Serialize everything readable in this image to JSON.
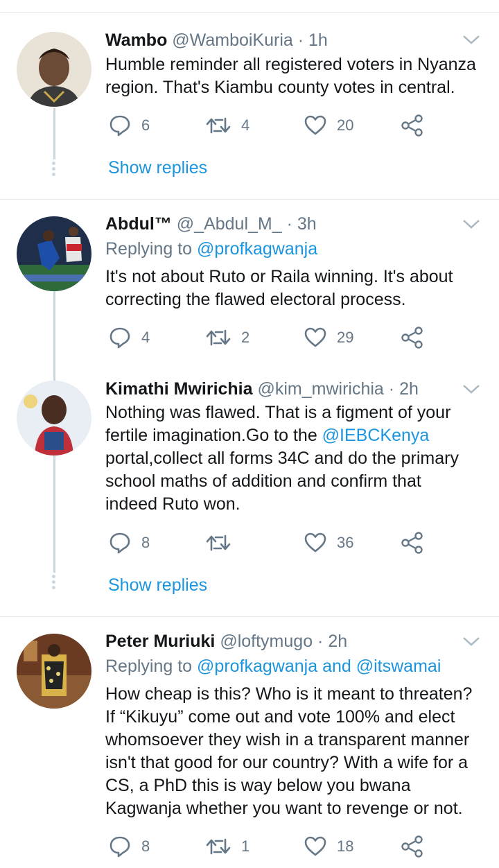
{
  "tweets": [
    {
      "name": "Wambo",
      "handle": "@WamboiKuria",
      "sep": "·",
      "time": "1h",
      "reply_prefix": "",
      "reply_users": [],
      "lines": [
        "Humble reminder all registered voters in Nyanza",
        "region. That's Kiambu county votes in central."
      ],
      "replies": "6",
      "retweets": "4",
      "likes": "20",
      "show_replies": "Show replies"
    },
    {
      "name": "Abdul™",
      "handle": "@_Abdul_M_",
      "sep": "·",
      "time": "3h",
      "reply_prefix": "Replying to",
      "reply_users": [
        "@profkagwanja"
      ],
      "lines": [
        "It's not about Ruto or Raila winning. It's about",
        "correcting the flawed electoral process."
      ],
      "replies": "4",
      "retweets": "2",
      "likes": "29"
    },
    {
      "name": "Kimathi Mwirichia",
      "handle": "@kim_mwirichia",
      "sep": "·",
      "time": "2h",
      "lines": [
        "Nothing was flawed. That is a figment of your",
        "fertile imagination.Go to the ",
        "@IEBCKenya",
        "portal,collect all forms 34C and do the primary",
        "school maths of addition and confirm that",
        "indeed Ruto won."
      ],
      "replies": "8",
      "retweets": "",
      "likes": "36",
      "show_replies": "Show replies"
    },
    {
      "name": "Peter Muriuki",
      "handle": "@loftymugo",
      "sep": "·",
      "time": "2h",
      "reply_prefix": "Replying to",
      "reply_users": [
        "@profkagwanja",
        "and",
        "@itswamai"
      ],
      "lines": [
        "How cheap is this? Who is it meant to threaten?",
        "If “Kikuyu” come out and vote 100% and elect",
        "whomsoever they wish in a transparent manner",
        "isn't that good for our country? With a wife for a",
        "CS, a PhD this is way below you bwana",
        "Kagwanja whether you want to revenge or not."
      ],
      "replies": "8",
      "retweets": "1",
      "likes": "18"
    }
  ],
  "colors": {
    "link": "#1b95e0",
    "meta": "#657786",
    "divider": "#e1e8ed",
    "thread": "#ccd6dd"
  },
  "icons": {
    "reply": "reply-icon",
    "retweet": "retweet-icon",
    "like": "like-icon",
    "share": "share-icon",
    "caret": "chevron-down-icon"
  }
}
